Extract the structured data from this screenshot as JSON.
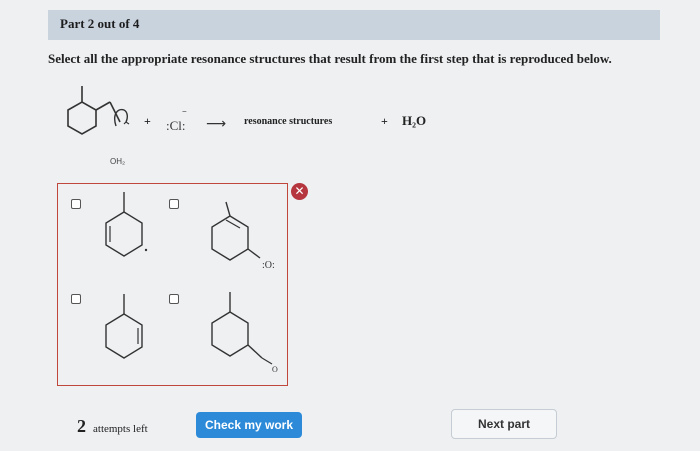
{
  "header": {
    "part_label": "Part 2 out of 4"
  },
  "question": {
    "instruction": "Select all the appropriate resonance structures that result from the first step that is reproduced below.",
    "reaction": {
      "plus1": "+",
      "chloride": ":Cl:",
      "chloride_charge": "−",
      "arrow": "⟶",
      "resonance_text": "resonance structures",
      "plus2": "+",
      "water": "H₂O",
      "oh2_label": "OH₂"
    }
  },
  "options": [
    {
      "id": "opt-1",
      "checked": false,
      "oxygen_label": ""
    },
    {
      "id": "opt-2",
      "checked": false,
      "oxygen_label": ":O:"
    },
    {
      "id": "opt-3",
      "checked": false,
      "oxygen_label": ""
    },
    {
      "id": "opt-4",
      "checked": false,
      "oxygen_label": "O"
    }
  ],
  "feedback": {
    "icon": "close-icon",
    "symbol": "✕",
    "color": "#b5363e"
  },
  "footer": {
    "attempts_count": "2",
    "attempts_label": "attempts left",
    "check_label": "Check my work",
    "next_label": "Next part"
  },
  "colors": {
    "accent": "#2c8ad8",
    "error": "#c0473c",
    "header_bg": "#c9d3de"
  }
}
